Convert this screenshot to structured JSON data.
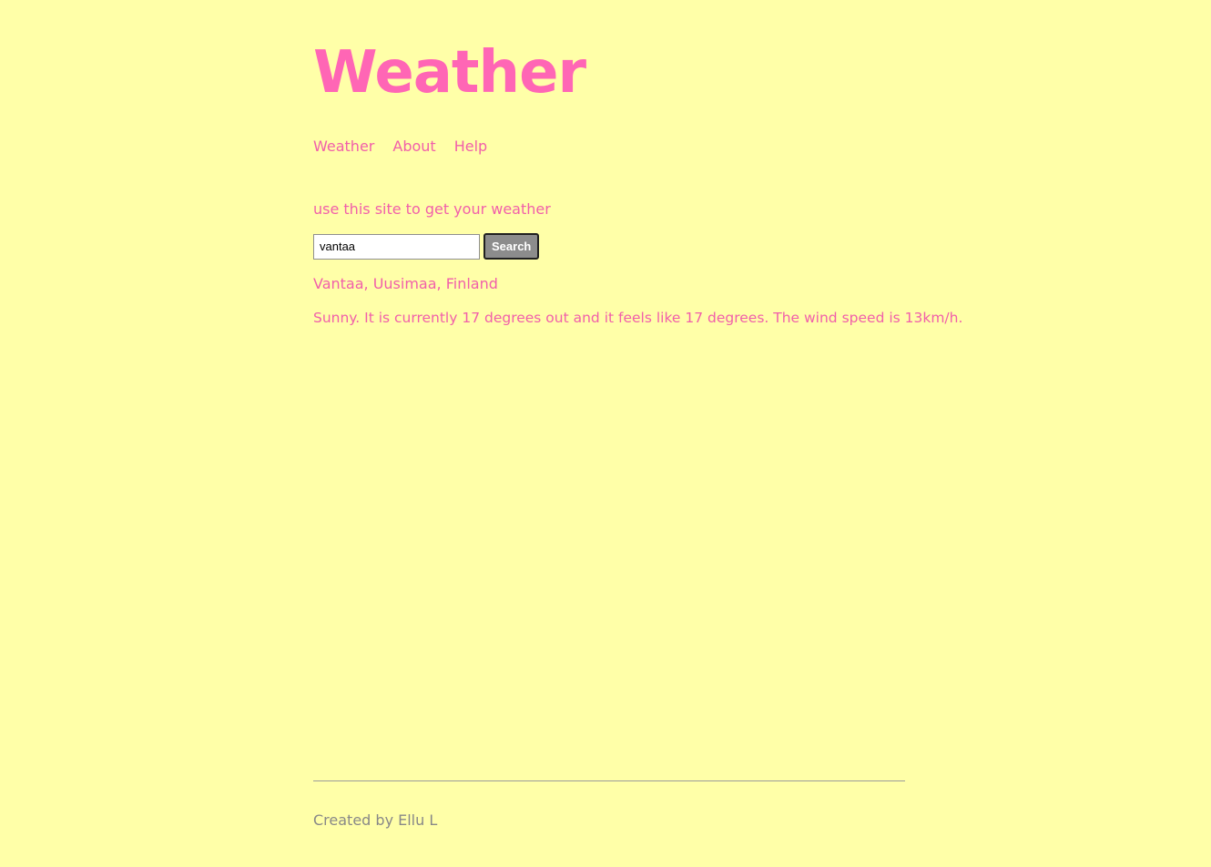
{
  "header": {
    "title": "Weather"
  },
  "nav": {
    "items": [
      {
        "label": "Weather"
      },
      {
        "label": "About"
      },
      {
        "label": "Help"
      }
    ]
  },
  "main": {
    "tagline": "use this site to get your weather",
    "search": {
      "value": "vantaa",
      "button_label": "Search"
    },
    "result": {
      "location": "Vantaa, Uusimaa, Finland",
      "forecast": "Sunny. It is currently 17 degrees out and it feels like 17 degrees. The wind speed is 13km/h."
    }
  },
  "footer": {
    "text": "Created by Ellu L"
  },
  "colors": {
    "background": "#ffffa8",
    "title": "#ff66b5",
    "text": "#f15faa",
    "footer_text": "#888888"
  }
}
